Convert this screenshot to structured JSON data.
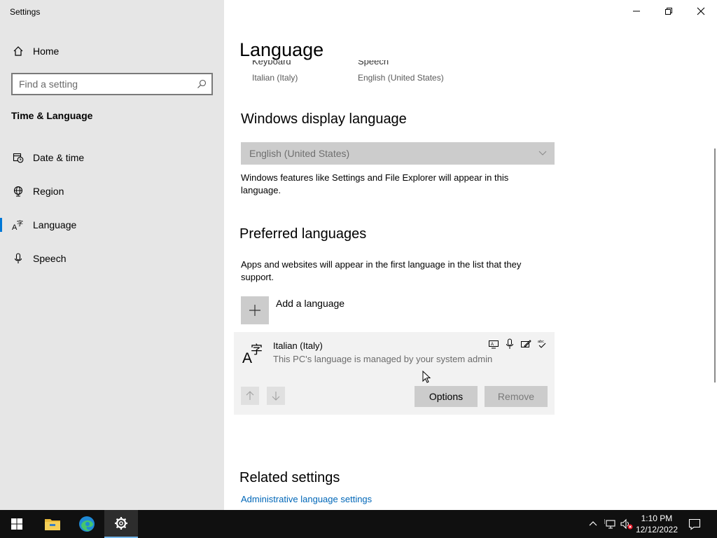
{
  "app": {
    "title": "Settings"
  },
  "sidebar": {
    "home_label": "Home",
    "search_placeholder": "Find a setting",
    "section_title": "Time & Language",
    "items": [
      {
        "label": "Date & time",
        "icon": "clock-calendar-icon"
      },
      {
        "label": "Region",
        "icon": "globe-icon"
      },
      {
        "label": "Language",
        "icon": "language-icon",
        "active": true
      },
      {
        "label": "Speech",
        "icon": "microphone-icon"
      }
    ]
  },
  "main": {
    "page_title": "Language",
    "top_partial": {
      "left_label": "Keyboard",
      "left_value": "Italian (Italy)",
      "right_label": "Speech",
      "right_value": "English (United States)"
    },
    "display_language": {
      "heading": "Windows display language",
      "selected": "English (United States)",
      "description": "Windows features like Settings and File Explorer will appear in this language."
    },
    "preferred": {
      "heading": "Preferred languages",
      "description": "Apps and websites will appear in the first language in the list that they support.",
      "add_label": "Add a language",
      "language": {
        "name": "Italian (Italy)",
        "subtitle": "This PC's language is managed by your system admin",
        "options_label": "Options",
        "remove_label": "Remove"
      }
    },
    "related": {
      "heading": "Related settings",
      "link": "Administrative language settings"
    }
  },
  "taskbar": {
    "time": "1:10 PM",
    "date": "12/12/2022",
    "apps": [
      "start-icon",
      "file-explorer-icon",
      "edge-icon",
      "settings-icon"
    ]
  },
  "colors": {
    "accent": "#0078d7",
    "link": "#0067b8",
    "taskbar": "#101010"
  }
}
